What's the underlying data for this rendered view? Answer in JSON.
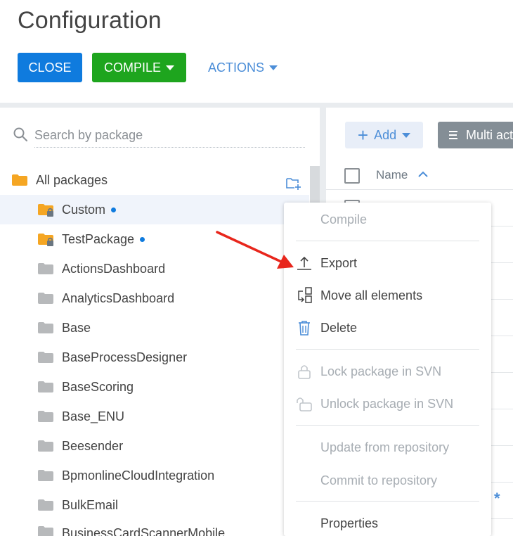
{
  "header": {
    "title": "Configuration",
    "close_label": "CLOSE",
    "compile_label": "COMPILE",
    "actions_label": "ACTIONS"
  },
  "search": {
    "placeholder": "Search by package"
  },
  "tree": {
    "root_label": "All packages",
    "items": [
      {
        "label": "Custom"
      },
      {
        "label": "TestPackage"
      },
      {
        "label": "ActionsDashboard"
      },
      {
        "label": "AnalyticsDashboard"
      },
      {
        "label": "Base"
      },
      {
        "label": "BaseProcessDesigner"
      },
      {
        "label": "BaseScoring"
      },
      {
        "label": "Base_ENU"
      },
      {
        "label": "Beesender"
      },
      {
        "label": "BpmonlineCloudIntegration"
      },
      {
        "label": "BulkEmail"
      },
      {
        "label": "BusinessCardScannerMobile"
      }
    ]
  },
  "right": {
    "add_label": "Add",
    "multi_label": "Multi actions",
    "name_column": "Name",
    "star": "*"
  },
  "menu": {
    "compile": "Compile",
    "export": "Export",
    "move_all": "Move all elements",
    "delete": "Delete",
    "lock": "Lock package in SVN",
    "unlock": "Unlock package in SVN",
    "update": "Update from repository",
    "commit": "Commit to repository",
    "properties": "Properties"
  },
  "colors": {
    "primary_blue": "#0f7bde",
    "compile_green": "#1ea51e",
    "link_blue": "#4c8ed8",
    "annotation_red": "#e8261c",
    "folder_orange": "#f5a623",
    "folder_gray": "#b7b9bb"
  }
}
